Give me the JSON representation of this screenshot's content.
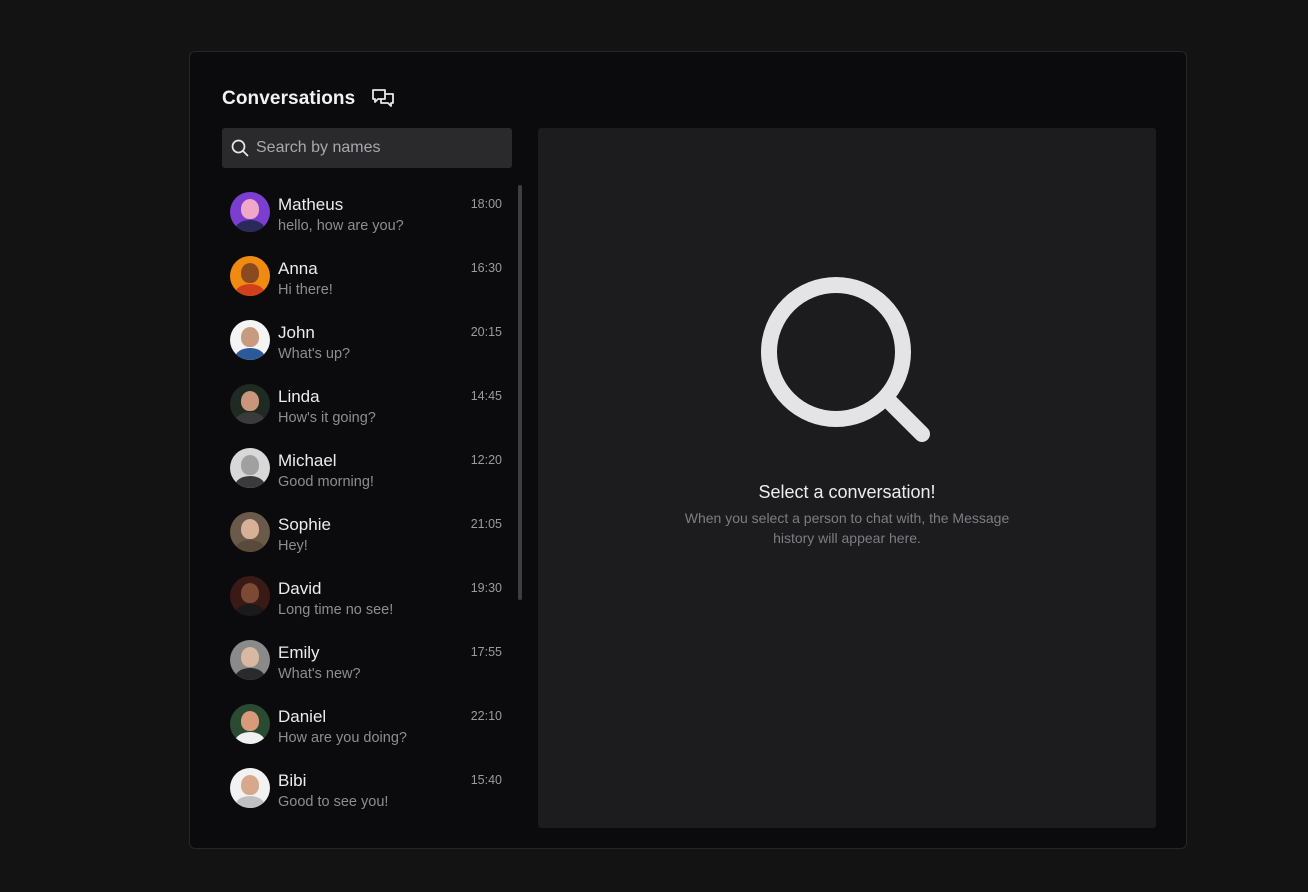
{
  "header": {
    "title": "Conversations",
    "icon": "chat-bubbles-icon"
  },
  "search": {
    "placeholder": "Search by names",
    "value": ""
  },
  "conversations": [
    {
      "name": "Matheus",
      "message": "hello, how are you?",
      "time": "18:00",
      "avatar_bg": "#7a3fd0",
      "skin": "#f0a8c8",
      "shirt": "#2a2a5a"
    },
    {
      "name": "Anna",
      "message": "Hi there!",
      "time": "16:30",
      "avatar_bg": "#f08a10",
      "skin": "#8a4a20",
      "shirt": "#d0401a"
    },
    {
      "name": "John",
      "message": "What's up?",
      "time": "20:15",
      "avatar_bg": "#f4f4f4",
      "skin": "#c89a80",
      "shirt": "#2a5a9a"
    },
    {
      "name": "Linda",
      "message": "How's it going?",
      "time": "14:45",
      "avatar_bg": "#1e2a22",
      "skin": "#c8967a",
      "shirt": "#3a3a3a"
    },
    {
      "name": "Michael",
      "message": "Good morning!",
      "time": "12:20",
      "avatar_bg": "#d8d8d8",
      "skin": "#a0a0a0",
      "shirt": "#3a3a3a"
    },
    {
      "name": "Sophie",
      "message": "Hey!",
      "time": "21:05",
      "avatar_bg": "#6a5a4a",
      "skin": "#d8b098",
      "shirt": "#5a4a3a"
    },
    {
      "name": "David",
      "message": "Long time no see!",
      "time": "19:30",
      "avatar_bg": "#3a1a14",
      "skin": "#7a4a34",
      "shirt": "#1a1a1a"
    },
    {
      "name": "Emily",
      "message": "What's new?",
      "time": "17:55",
      "avatar_bg": "#8a8a8a",
      "skin": "#d8b8a0",
      "shirt": "#2a2a2a"
    },
    {
      "name": "Daniel",
      "message": "How are you doing?",
      "time": "22:10",
      "avatar_bg": "#2a4a32",
      "skin": "#d89a7a",
      "shirt": "#f0f0f0"
    },
    {
      "name": "Bibi",
      "message": "Good to see you!",
      "time": "15:40",
      "avatar_bg": "#f2f2f2",
      "skin": "#d8a88a",
      "shirt": "#c0c0c0"
    }
  ],
  "empty_state": {
    "icon": "search-icon",
    "title": "Select a conversation!",
    "text": "When you select a person to chat with, the Message history will appear here."
  }
}
